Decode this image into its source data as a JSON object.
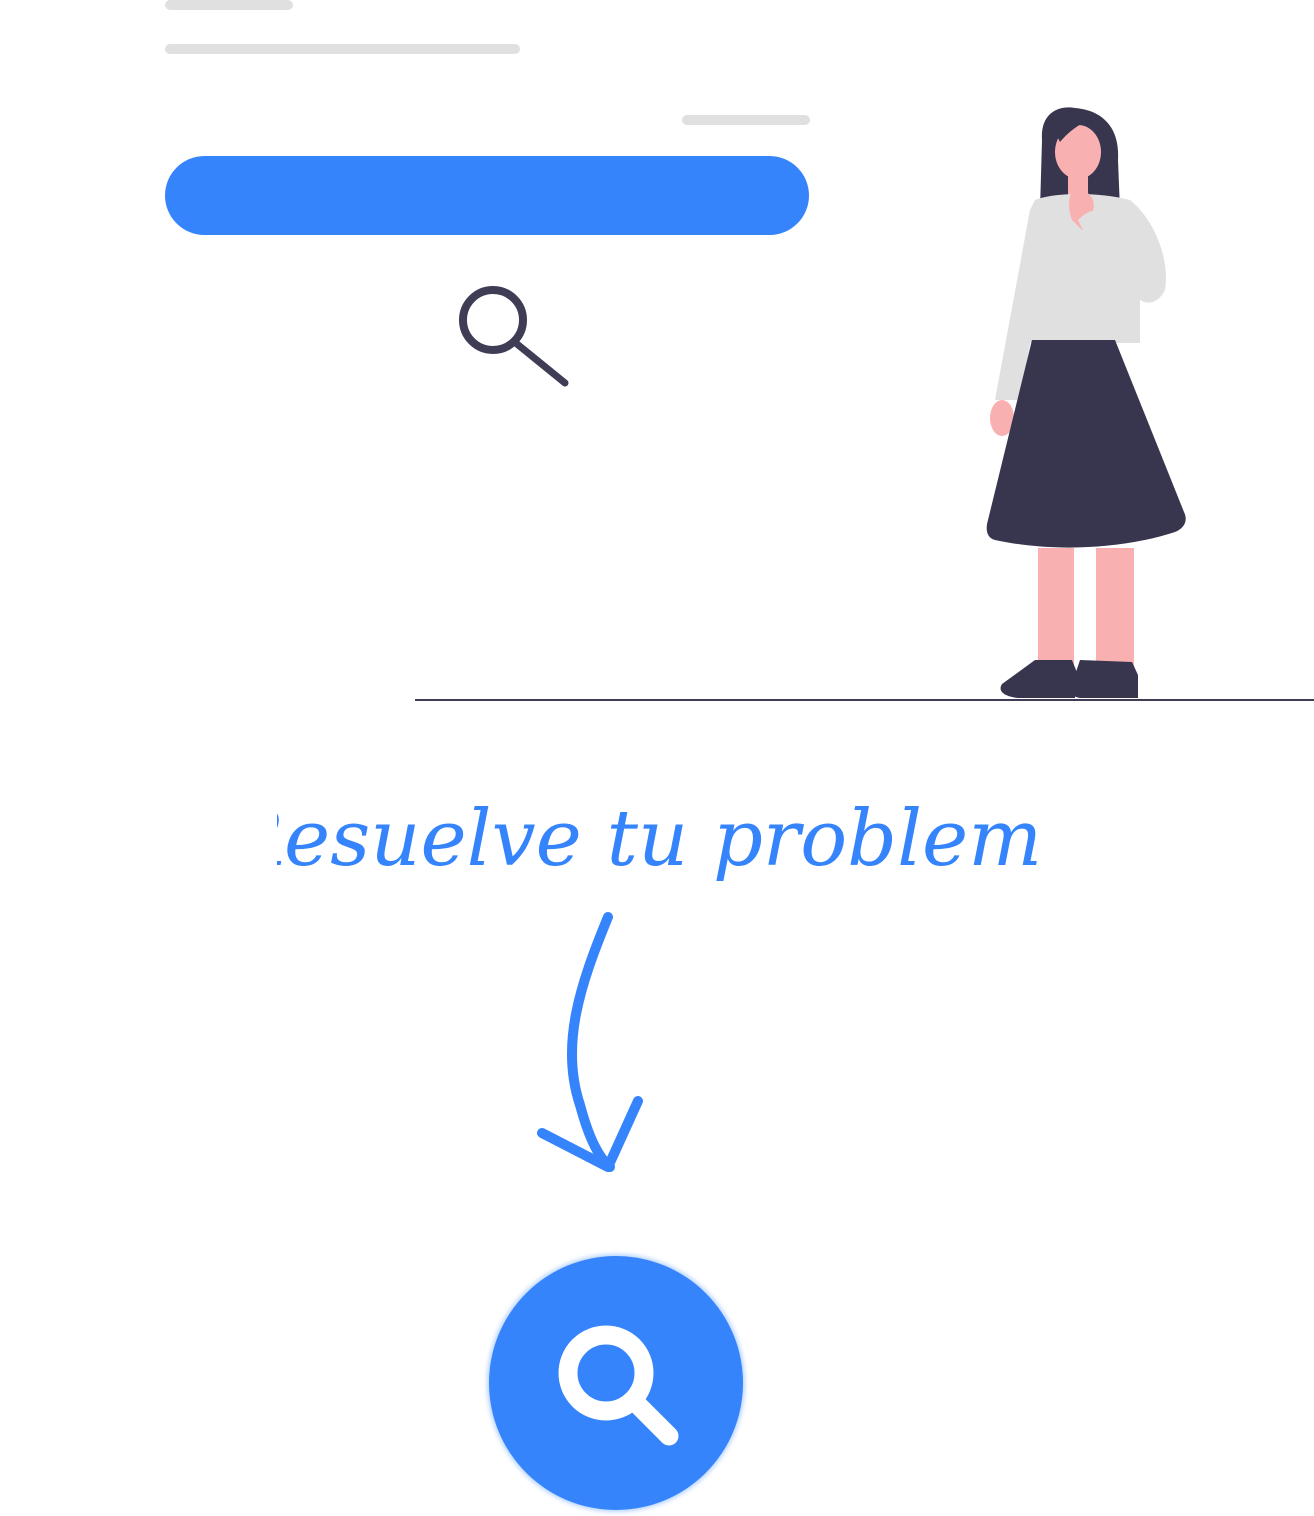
{
  "headline": {
    "text": "Resuelve tu problema"
  },
  "colors": {
    "accent": "#3584fc",
    "placeholder": "#e0e0e0",
    "dark": "#3f3d56",
    "skin": "#f9b0b1",
    "shirt": "#e0e0e0",
    "skirt": "#38354f",
    "background": "#ffffff"
  },
  "icons": {
    "small_search": "magnifier-icon",
    "arrow": "curved-arrow-down-icon",
    "button": "search-icon"
  }
}
